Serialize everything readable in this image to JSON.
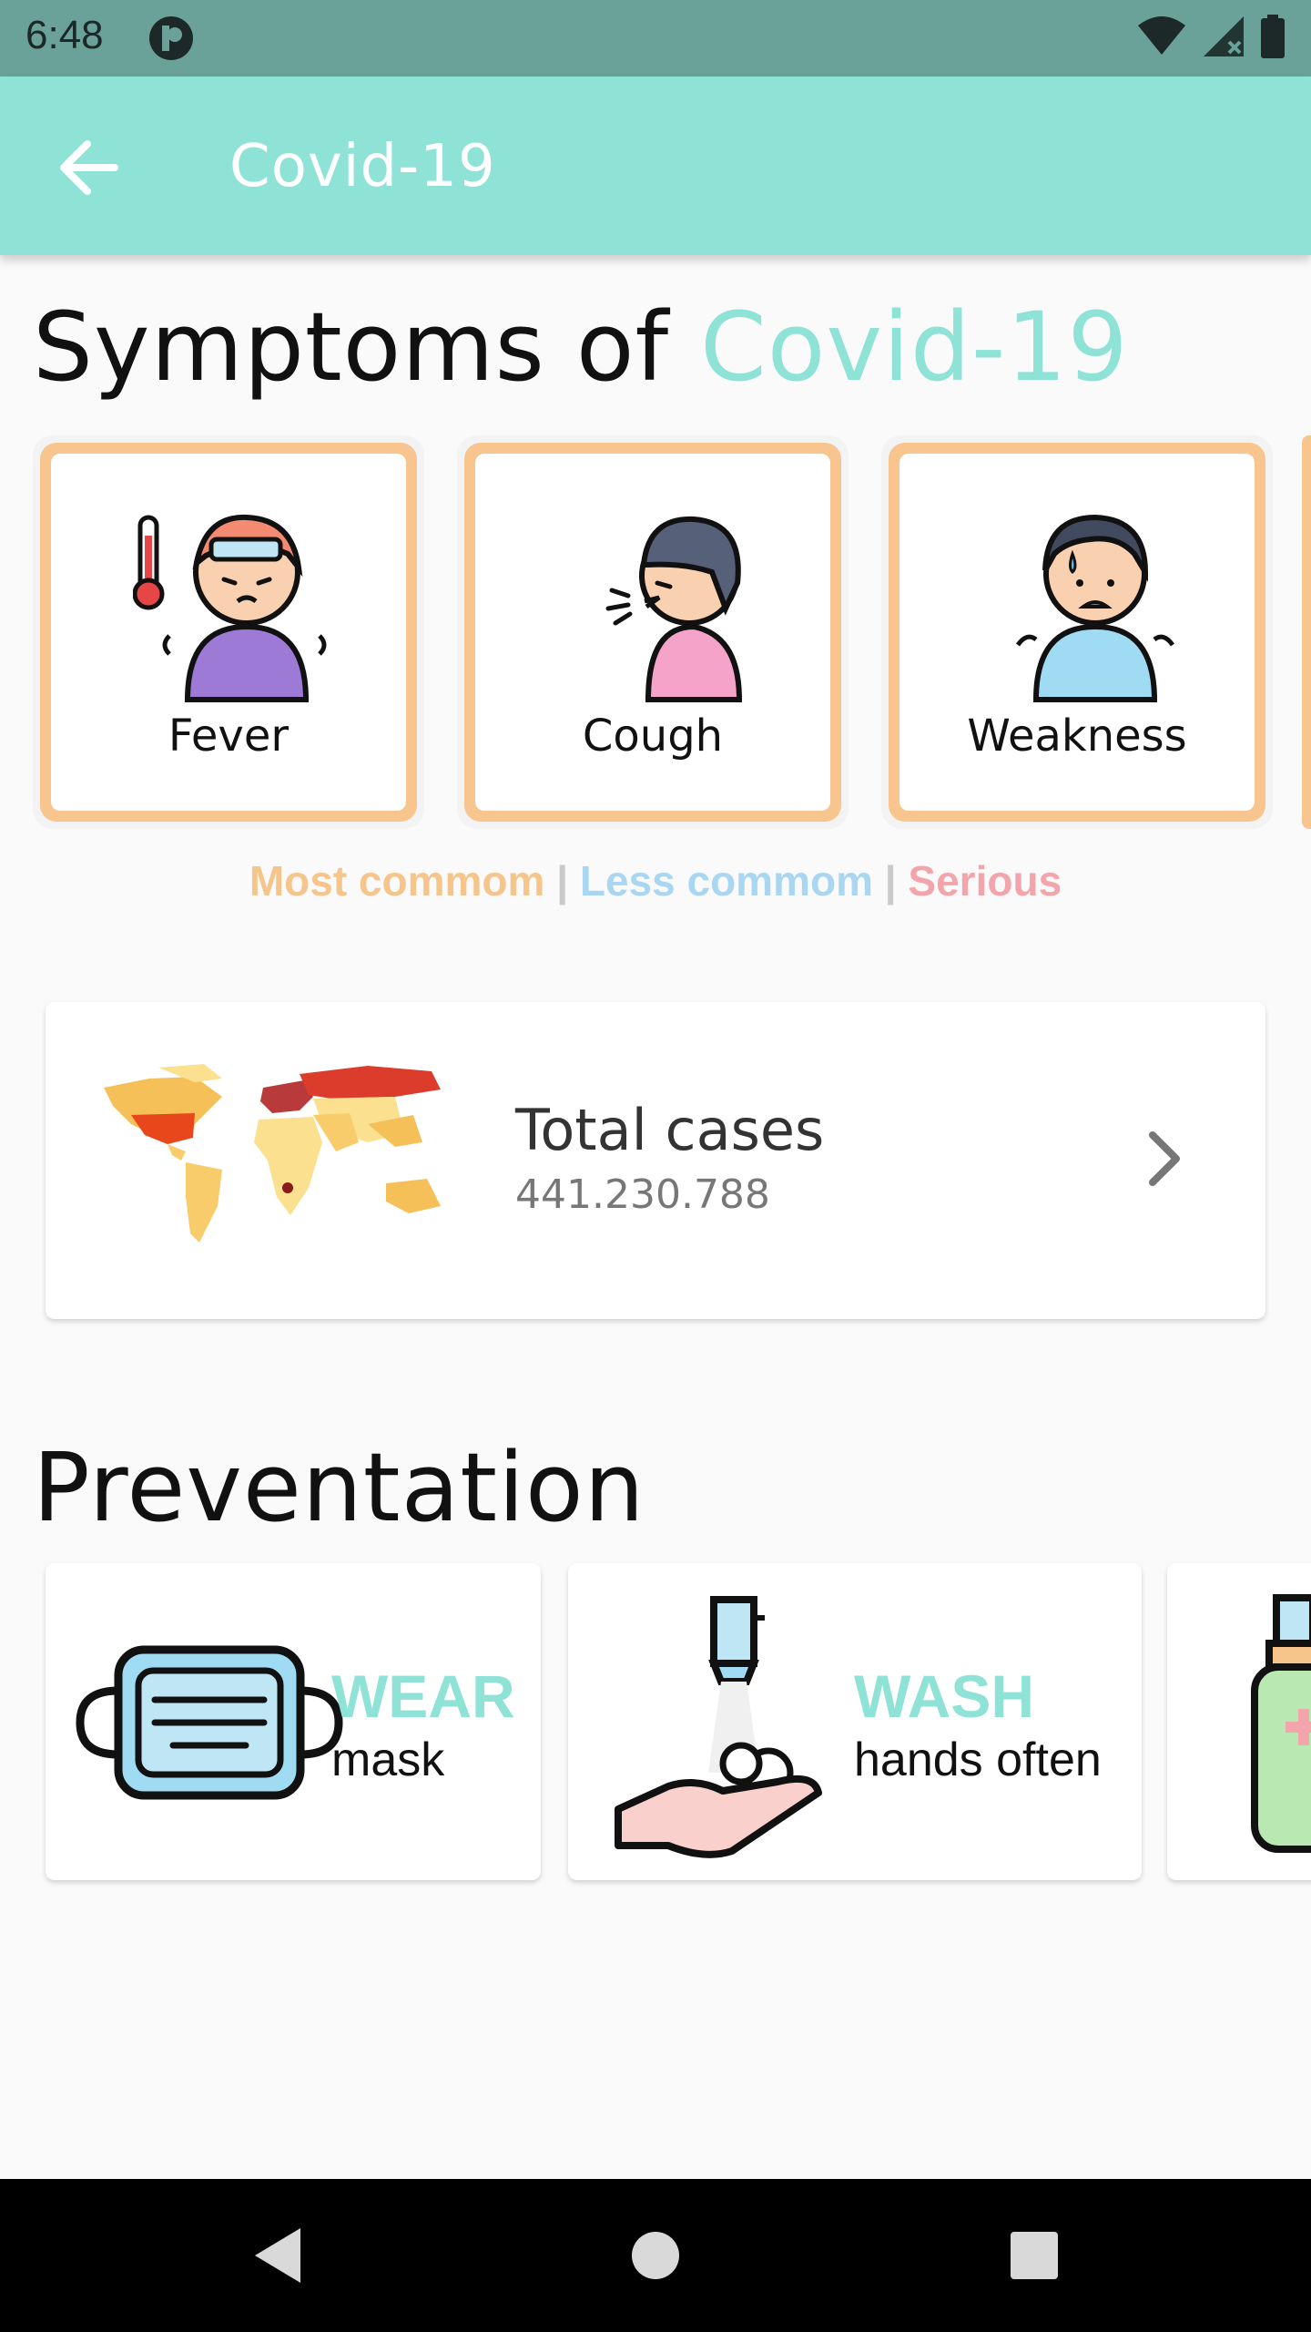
{
  "status_bar": {
    "time": "6:48"
  },
  "app_bar": {
    "title": "Covid-19"
  },
  "symptoms": {
    "title_main": "Symptoms of ",
    "title_accent": "Covid-19",
    "items": [
      {
        "label": "Fever",
        "icon": "fever-person-icon"
      },
      {
        "label": "Cough",
        "icon": "cough-person-icon"
      },
      {
        "label": "Weakness",
        "icon": "weakness-person-icon"
      }
    ],
    "legend": {
      "most": "Most commom",
      "sep": " | ",
      "less": "Less commom",
      "serious": "Serious"
    },
    "colors": {
      "most": "#f6c58c",
      "less": "#a9d6f1",
      "serious": "#f2a5ab"
    }
  },
  "cases": {
    "title": "Total cases",
    "value": "441.230.788"
  },
  "prevention": {
    "title": "Preventation",
    "items": [
      {
        "head": "WEAR",
        "sub": "mask",
        "icon": "face-mask-icon"
      },
      {
        "head": "WASH",
        "sub": "hands often",
        "icon": "hand-wash-icon"
      },
      {
        "head": "",
        "sub": "",
        "icon": "sanitizer-icon"
      }
    ]
  },
  "theme": {
    "accent": "#8ee3d6",
    "status_bar": "#6aa199"
  }
}
